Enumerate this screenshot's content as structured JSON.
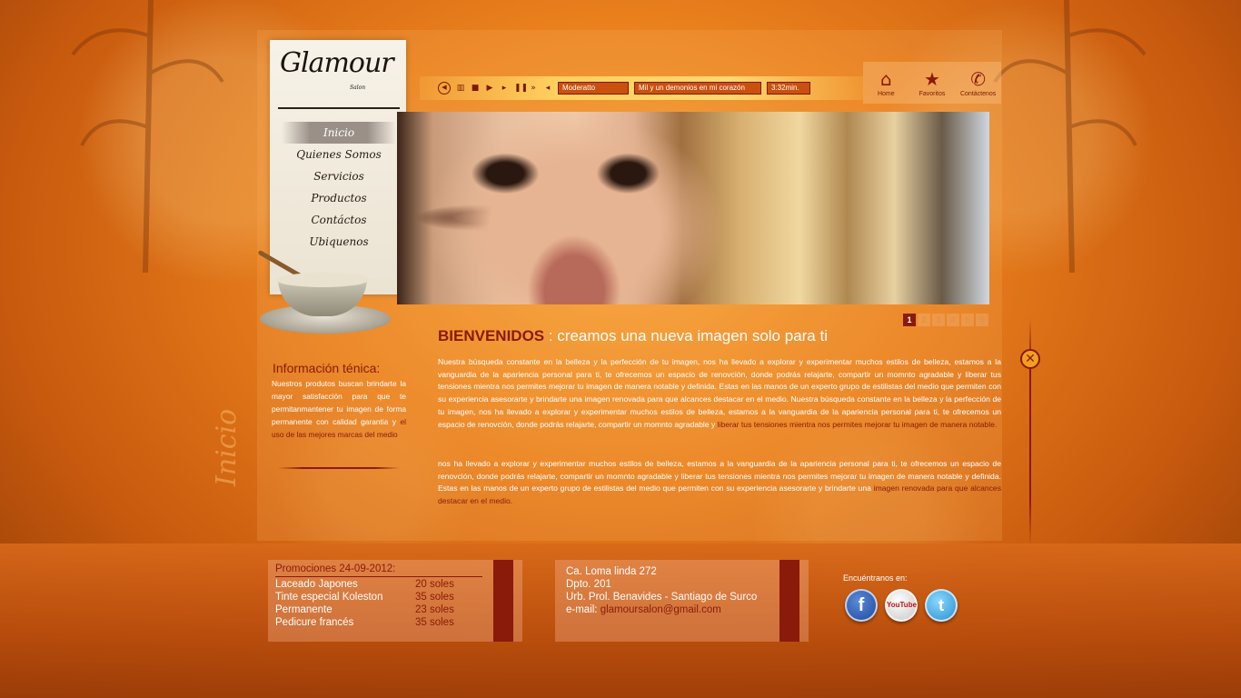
{
  "logo": {
    "text": "Glamour",
    "sub": "Salon"
  },
  "menu": [
    "Inicio",
    "Quienes Somos",
    "Servicios",
    "Productos",
    "Contáctos",
    "Ubiquenos"
  ],
  "player": {
    "genre": "Moderatto",
    "song": "Mil y un demonios en mi corazón",
    "duration": "3:32min."
  },
  "topnav": [
    {
      "label": "Home",
      "icon": "home-icon"
    },
    {
      "label": "Favoritos",
      "icon": "star-icon"
    },
    {
      "label": "Contáctenos",
      "icon": "phone-icon"
    }
  ],
  "slides": [
    "1",
    "2",
    "3",
    "4",
    "5",
    "6"
  ],
  "welcome": {
    "strong": "BIENVENIDOS",
    "rest": " : creamos una nueva imagen solo para ti"
  },
  "paragraph1": {
    "text": "Nuestra búsqueda constante en la belleza y la perfección de tu imagen, nos ha llevado a explorar y experimentar muchos estilos de belleza, estamos a la vanguardia de la apariencia personal para ti, te ofrecemos un espacio de renovción, donde podrás relajarte, compartir un momnto agradable y liberar tus tensiones mientra nos permites mejorar tu imagen de manera notable y definida. Estas en las manos de un experto grupo de estilistas del medio que permiten con su experiencia asesorarte y brindarte una imagen renovada para que alcances destacar en el medio.  Nuestra búsqueda constante en la belleza y la perfección de tu imagen, nos ha llevado a explorar y experimentar muchos estilos de belleza, estamos a la vanguardia de la apariencia personal para ti, te ofrecemos un espacio de renovción, donde podrás relajarte, compartir un momnto agradable y ",
    "highlight": "liberar tus tensiones mientra nos permites mejorar tu imagen de manera notable."
  },
  "paragraph2": {
    "text": "nos ha llevado a explorar y experimentar muchos estilos de belleza, estamos a la vanguardia de la apariencia personal para ti, te ofrecemos un espacio de renovción, donde podrás relajarte, compartir un momnto agradable y liberar tus tensiones mientra nos permites mejorar tu imagen de manera notable y definida. Estas en las manos de un experto grupo de estilistas del medio que permiten con su experiencia asesorarte y brindarte una ",
    "highlight": "imagen renovada para que alcances destacar en el medio."
  },
  "info": {
    "title": "Información ténica:",
    "text": "Nuestros produtos buscan brindarte la mayor satisfacción para que te permitanmantener tu imagen de forma permanente con calidad garantia y ",
    "highlight": "el uso de las mejores marcas del medio"
  },
  "side_word": "Inicio",
  "promo": {
    "title": "Promociones 24-09-2012:",
    "items": [
      {
        "name": "Laceado Japones",
        "price": "20 soles"
      },
      {
        "name": "Tinte especial Koleston",
        "price": "35 soles"
      },
      {
        "name": "Permanente",
        "price": "23 soles"
      },
      {
        "name": "Pedicure francés",
        "price": "35 soles"
      }
    ]
  },
  "address": {
    "line1": "Ca. Loma linda 272",
    "line2": "Dpto. 201",
    "line3": "Urb. Prol. Benavides - Santiago de Surco",
    "email_label": "e-mail: ",
    "email": "glamoursalon@gmail.com"
  },
  "social": {
    "title": "Encuéntranos en:",
    "facebook": "f",
    "youtube": "YouTube",
    "twitter": "t"
  },
  "colors": {
    "accent": "#8a1a0a",
    "background": "#e9801d"
  }
}
